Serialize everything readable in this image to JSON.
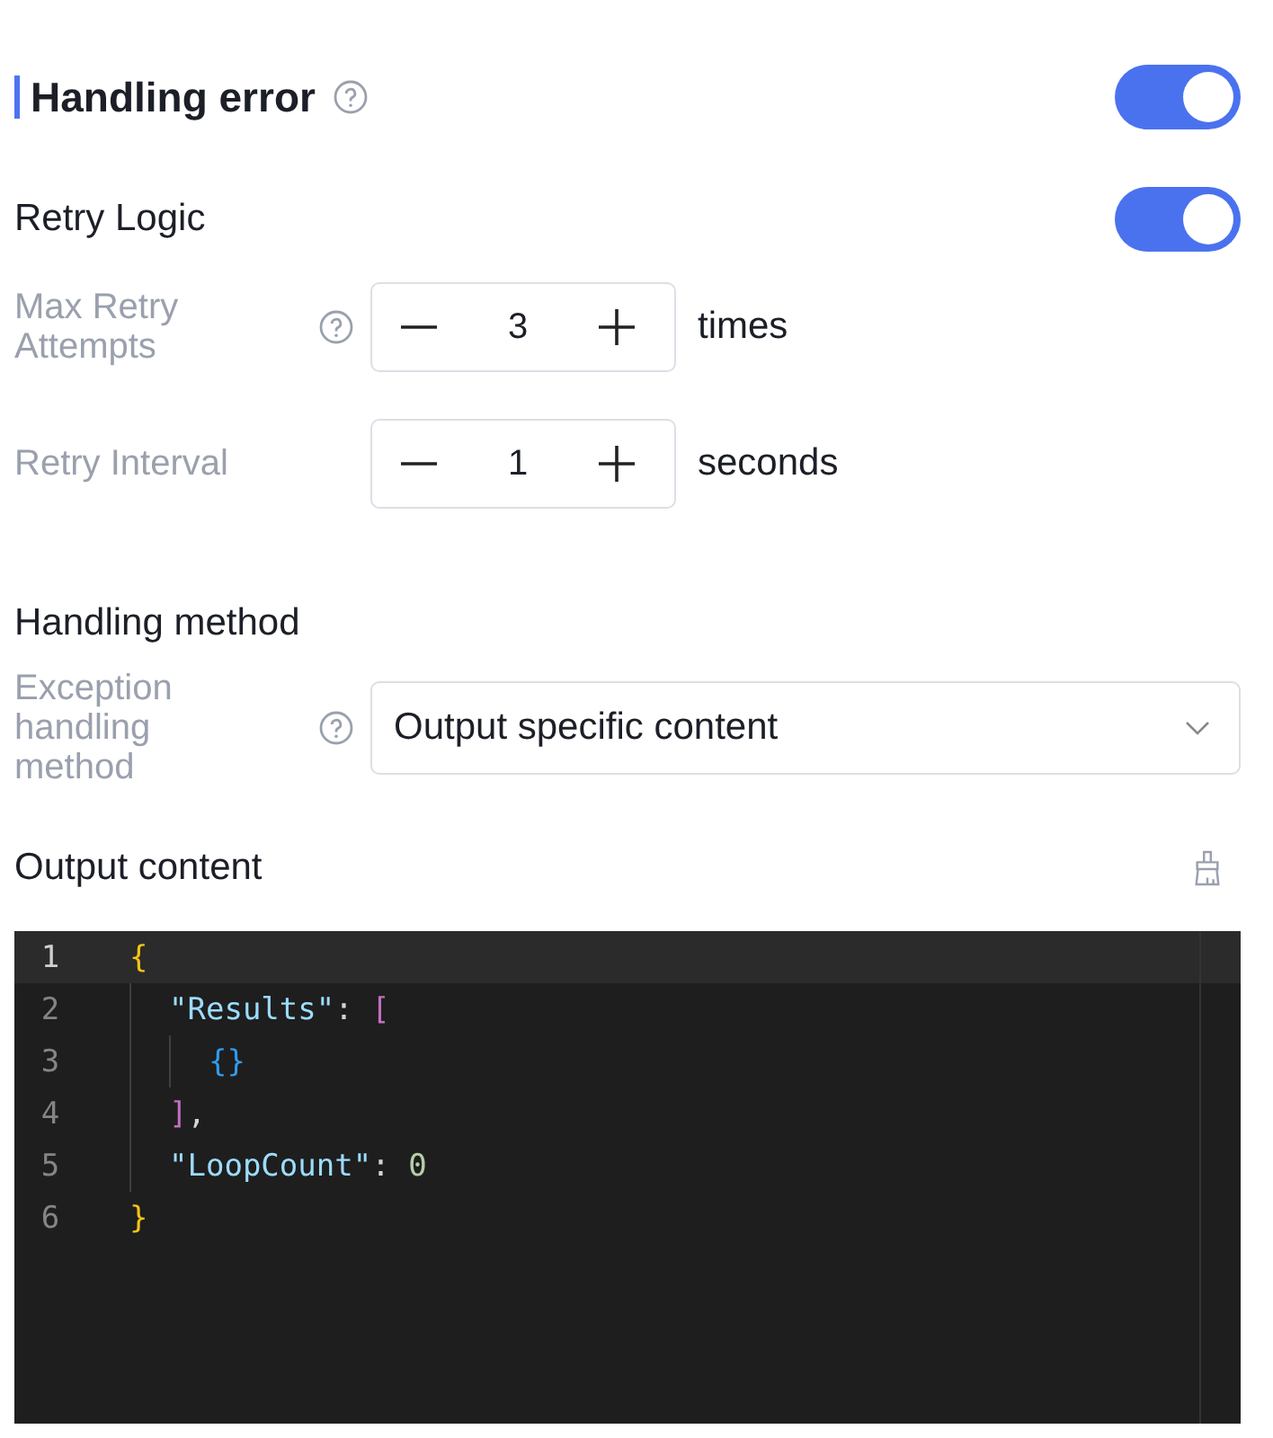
{
  "section": {
    "title": "Handling error",
    "enabled": true
  },
  "retry": {
    "title": "Retry Logic",
    "enabled": true,
    "fields": [
      {
        "label": "Max Retry Attempts",
        "help": true,
        "value": "3",
        "unit": "times"
      },
      {
        "label": "Retry Interval",
        "help": false,
        "value": "1",
        "unit": "seconds"
      }
    ]
  },
  "method": {
    "title": "Handling method",
    "label": "Exception handling method",
    "help": true,
    "value": "Output specific content"
  },
  "output": {
    "title": "Output content",
    "lines": [
      {
        "number": "1",
        "current": true,
        "tokens": [
          {
            "text": "{",
            "kind": "braceopen"
          }
        ]
      },
      {
        "number": "2",
        "current": false,
        "tokens": [
          {
            "text": "\"Results\"",
            "kind": "key"
          },
          {
            "text": ": ",
            "kind": "plain"
          },
          {
            "text": "[",
            "kind": "bracketopen"
          }
        ]
      },
      {
        "number": "3",
        "current": false,
        "tokens": [
          {
            "text": "{}",
            "kind": "inner"
          }
        ]
      },
      {
        "number": "4",
        "current": false,
        "tokens": [
          {
            "text": "]",
            "kind": "bracketclose"
          },
          {
            "text": ",",
            "kind": "plain"
          }
        ]
      },
      {
        "number": "5",
        "current": false,
        "tokens": [
          {
            "text": "\"LoopCount\"",
            "kind": "key"
          },
          {
            "text": ": ",
            "kind": "plain"
          },
          {
            "text": "0",
            "kind": "number"
          }
        ]
      },
      {
        "number": "6",
        "current": false,
        "tokens": [
          {
            "text": "}",
            "kind": "braceclose"
          }
        ]
      }
    ]
  }
}
